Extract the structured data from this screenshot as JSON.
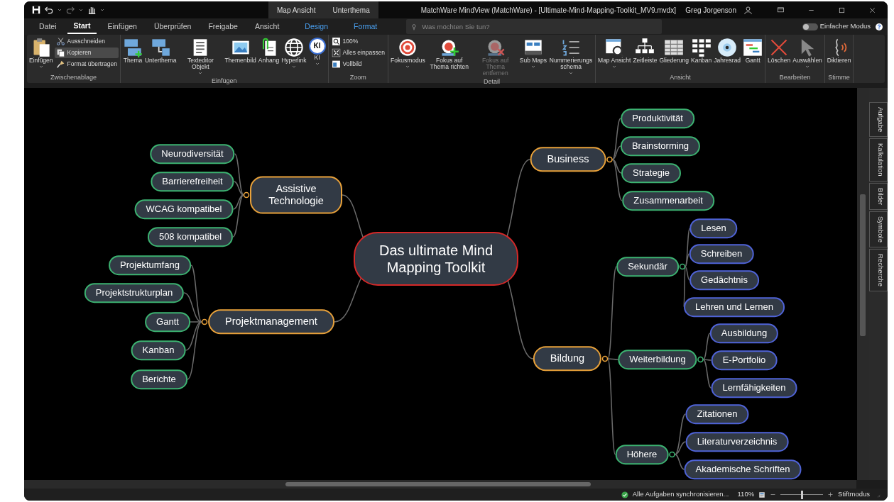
{
  "title_bar": {
    "context_tabs": [
      {
        "label": "Map Ansicht"
      },
      {
        "label": "Unterthema"
      }
    ],
    "title": "MatchWare MindView (MatchWare) - [Ultimate-Mind-Mapping-Toolkit_MV9.mvdx]",
    "user": "Greg Jorgenson"
  },
  "ribbon_tabs": [
    {
      "label": "Datei",
      "selected": false,
      "kind": "normal"
    },
    {
      "label": "Start",
      "selected": true,
      "kind": "normal"
    },
    {
      "label": "Einfügen",
      "selected": false,
      "kind": "normal"
    },
    {
      "label": "Überprüfen",
      "selected": false,
      "kind": "normal"
    },
    {
      "label": "Freigabe",
      "selected": false,
      "kind": "normal"
    },
    {
      "label": "Ansicht",
      "selected": false,
      "kind": "normal"
    },
    {
      "label": "Design",
      "selected": false,
      "kind": "context"
    },
    {
      "label": "Format",
      "selected": false,
      "kind": "context"
    }
  ],
  "search": {
    "placeholder": "Was möchten Sie tun?"
  },
  "simple_mode": {
    "label": "Einfacher Modus",
    "on": false
  },
  "ribbon_groups": [
    {
      "label": "Zwischenablage",
      "buttons": [
        {
          "label": "Einfügen",
          "kind": "large",
          "dropdown": true,
          "disabled": false,
          "highlighted": false
        },
        {
          "label": "Ausschneiden",
          "kind": "small",
          "dropdown": false,
          "disabled": false,
          "highlighted": false
        },
        {
          "label": "Kopieren",
          "kind": "small",
          "dropdown": false,
          "disabled": false,
          "highlighted": true
        },
        {
          "label": "Format übertragen",
          "kind": "small",
          "dropdown": false,
          "disabled": false,
          "highlighted": false
        }
      ]
    },
    {
      "label": "Einfügen",
      "buttons": [
        {
          "label": "Thema",
          "kind": "large",
          "dropdown": false,
          "disabled": false,
          "highlighted": false
        },
        {
          "label": "Unterthema",
          "kind": "large",
          "dropdown": false,
          "disabled": false,
          "highlighted": false
        },
        {
          "label": "Texteditor Objekt",
          "kind": "large",
          "dropdown": true,
          "disabled": false,
          "highlighted": false
        },
        {
          "label": "Themenbild",
          "kind": "large",
          "dropdown": false,
          "disabled": false,
          "highlighted": false
        },
        {
          "label": "Anhang",
          "kind": "large",
          "dropdown": false,
          "disabled": false,
          "highlighted": false
        },
        {
          "label": "Hyperlink",
          "kind": "large",
          "dropdown": true,
          "disabled": false,
          "highlighted": false
        },
        {
          "label": "KI",
          "kind": "badge",
          "badge": "KI",
          "dropdown": true,
          "disabled": false,
          "highlighted": false
        }
      ]
    },
    {
      "label": "Zoom",
      "buttons": [
        {
          "label": "100%",
          "kind": "small",
          "dropdown": false,
          "disabled": false,
          "highlighted": false
        },
        {
          "label": "Alles einpassen",
          "kind": "small",
          "dropdown": false,
          "disabled": false,
          "highlighted": false
        },
        {
          "label": "Vollbild",
          "kind": "small",
          "dropdown": false,
          "disabled": false,
          "highlighted": false
        }
      ]
    },
    {
      "label": "Detail",
      "buttons": [
        {
          "label": "Fokusmodus",
          "kind": "large",
          "dropdown": true,
          "disabled": false,
          "highlighted": false
        },
        {
          "label": "Fokus auf Thema richten",
          "kind": "large",
          "dropdown": false,
          "disabled": false,
          "highlighted": false
        },
        {
          "label": "Fokus auf Thema entfernen",
          "kind": "large",
          "dropdown": false,
          "disabled": true,
          "highlighted": false
        },
        {
          "label": "Sub Maps",
          "kind": "large",
          "dropdown": true,
          "disabled": false,
          "highlighted": false
        },
        {
          "label": "Nummerierungs schema",
          "kind": "large",
          "dropdown": true,
          "disabled": false,
          "highlighted": false
        }
      ]
    },
    {
      "label": "Ansicht",
      "buttons": [
        {
          "label": "Map Ansicht",
          "kind": "large",
          "dropdown": true,
          "disabled": false,
          "highlighted": false
        },
        {
          "label": "Zeitleiste",
          "kind": "large",
          "dropdown": false,
          "disabled": false,
          "highlighted": false
        },
        {
          "label": "Gliederung",
          "kind": "large",
          "dropdown": false,
          "disabled": false,
          "highlighted": false
        },
        {
          "label": "Kanban",
          "kind": "large",
          "dropdown": false,
          "disabled": false,
          "highlighted": false
        },
        {
          "label": "Jahresrad",
          "kind": "large",
          "dropdown": false,
          "disabled": false,
          "highlighted": false
        },
        {
          "label": "Gantt",
          "kind": "large",
          "dropdown": false,
          "disabled": false,
          "highlighted": false
        }
      ]
    },
    {
      "label": "Bearbeiten",
      "buttons": [
        {
          "label": "Löschen",
          "kind": "large",
          "dropdown": false,
          "disabled": false,
          "highlighted": false
        },
        {
          "label": "Auswählen",
          "kind": "large",
          "dropdown": true,
          "disabled": false,
          "highlighted": false
        }
      ]
    },
    {
      "label": "Stimme",
      "buttons": [
        {
          "label": "Diktieren",
          "kind": "large",
          "dropdown": false,
          "disabled": false,
          "highlighted": false
        }
      ]
    }
  ],
  "mind_map": {
    "label": "Das ultimate Mind Mapping Toolkit",
    "children": [
      {
        "label": "Assistive Technologie",
        "children": [
          {
            "label": "Neurodiversität"
          },
          {
            "label": "Barrierefreiheit"
          },
          {
            "label": "WCAG kompatibel"
          },
          {
            "label": "508 kompatibel"
          }
        ]
      },
      {
        "label": "Projektmanagement",
        "children": [
          {
            "label": "Projektumfang"
          },
          {
            "label": "Projektstrukturplan"
          },
          {
            "label": "Gantt"
          },
          {
            "label": "Kanban"
          },
          {
            "label": "Berichte"
          }
        ]
      },
      {
        "label": "Business",
        "children": [
          {
            "label": "Produktivität"
          },
          {
            "label": "Brainstorming"
          },
          {
            "label": "Strategie"
          },
          {
            "label": "Zusammenarbeit"
          }
        ]
      },
      {
        "label": "Bildung",
        "children": [
          {
            "label": "Sekundär",
            "children": [
              {
                "label": "Lesen"
              },
              {
                "label": "Schreiben"
              },
              {
                "label": "Gedächtnis"
              },
              {
                "label": "Lehren und Lernen"
              }
            ]
          },
          {
            "label": "Weiterbildung",
            "children": [
              {
                "label": "Ausbildung"
              },
              {
                "label": "E-Portfolio"
              },
              {
                "label": "Lernfähigkeiten"
              }
            ]
          },
          {
            "label": "Höhere",
            "children": [
              {
                "label": "Zitationen"
              },
              {
                "label": "Literaturverzeichnis"
              },
              {
                "label": "Akademische Schriften"
              }
            ]
          }
        ]
      }
    ]
  },
  "side_tabs": [
    {
      "label": "Aufgabe"
    },
    {
      "label": "Kalkulation"
    },
    {
      "label": "Bilder"
    },
    {
      "label": "Symbole"
    },
    {
      "label": "Recherche"
    }
  ],
  "status_bar": {
    "sync": "Alle Aufgaben synchronisieren...",
    "zoom": "110%",
    "zoom_slider": {
      "level": 0.5
    },
    "pen_mode": "Stiftmodus"
  }
}
